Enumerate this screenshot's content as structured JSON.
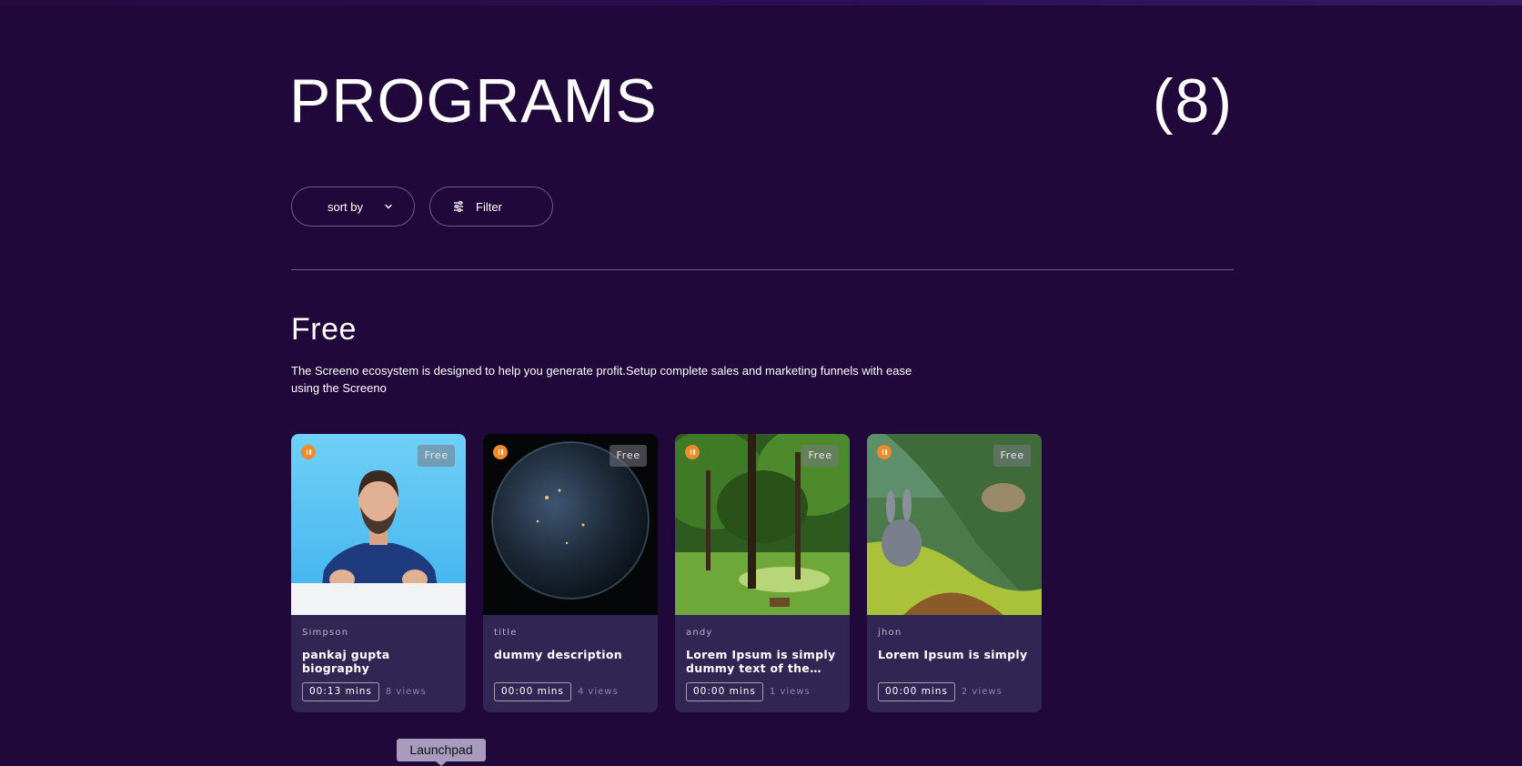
{
  "header": {
    "title": "PROGRAMS",
    "count": "(8)"
  },
  "controls": {
    "sort_label": "sort by",
    "filter_label": "Filter"
  },
  "section": {
    "title": "Free",
    "description_line1": "The Screeno ecosystem is designed to help you generate profit.Setup complete sales and marketing funnels with ease",
    "description_line2": "using the Screeno"
  },
  "cards": [
    {
      "tag": "Free",
      "author": "Simpson",
      "title": "pankaj gupta biography",
      "duration": "00:13 mins",
      "views": "8 views",
      "thumb_icon": "presenter-thumbnail"
    },
    {
      "tag": "Free",
      "author": "title",
      "title": "dummy description",
      "duration": "00:00 mins",
      "views": "4 views",
      "thumb_icon": "earth-thumbnail"
    },
    {
      "tag": "Free",
      "author": "andy",
      "title": "Lorem Ipsum is simply dummy text of the…",
      "duration": "00:00 mins",
      "views": "1 views",
      "thumb_icon": "forest-thumbnail"
    },
    {
      "tag": "Free",
      "author": "jhon",
      "title": "Lorem Ipsum is simply",
      "duration": "00:00 mins",
      "views": "2 views",
      "thumb_icon": "bunny-thumbnail"
    }
  ],
  "dock_tooltip": {
    "label": "Launchpad"
  },
  "colors": {
    "background": "#21083a",
    "card": "#312653",
    "accent": "#f08a2a"
  }
}
